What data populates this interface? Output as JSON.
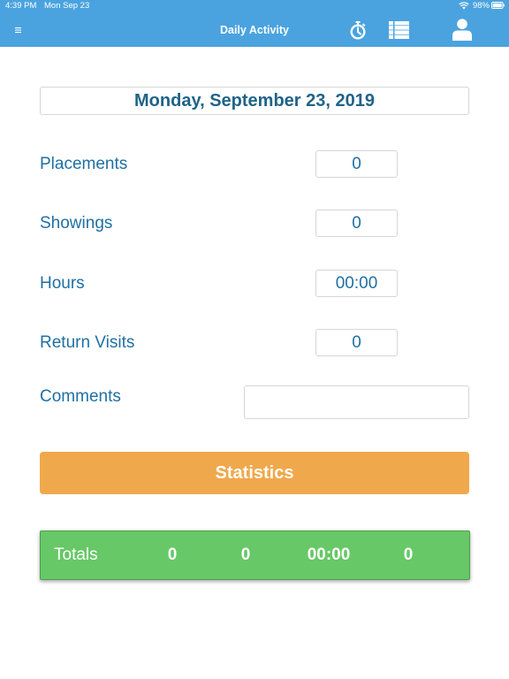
{
  "status_bar": {
    "time": "4:39 PM",
    "date": "Mon Sep 23",
    "battery": "98%"
  },
  "nav": {
    "title": "Daily Activity",
    "icons": [
      "menu-icon",
      "timer-icon",
      "list-icon",
      "person-icon"
    ]
  },
  "date_selector": {
    "label": "Monday, September 23, 2019"
  },
  "fields": [
    {
      "label": "Placements",
      "value": "0"
    },
    {
      "label": "Showings",
      "value": "0"
    },
    {
      "label": "Hours",
      "value": "00:00"
    },
    {
      "label": "Return Visits",
      "value": "0"
    }
  ],
  "comments": {
    "label": "Comments",
    "value": ""
  },
  "statistics_button": {
    "label": "Statistics"
  },
  "totals": {
    "label": "Totals",
    "values": [
      "0",
      "0",
      "00:00",
      "0"
    ]
  },
  "colors": {
    "header": "#4aa3df",
    "text": "#1f6fa3",
    "statistics_button": "#f0a84c",
    "totals_bar": "#67c867"
  }
}
